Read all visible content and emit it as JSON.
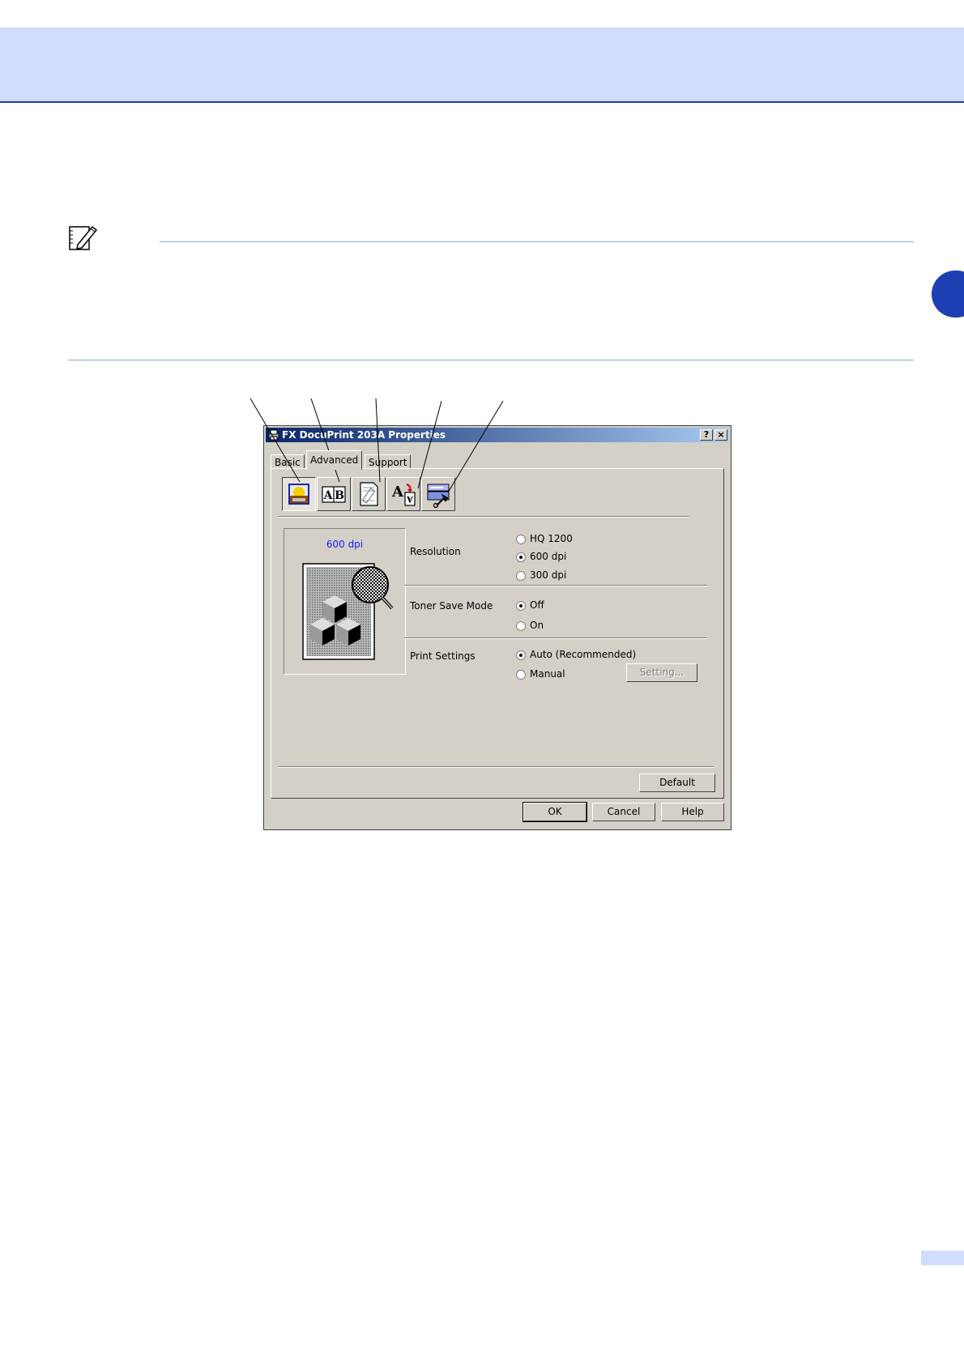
{
  "dialog": {
    "title": "FX DocuPrint 203A Properties",
    "help_glyph": "?",
    "close_glyph": "×",
    "tabs": [
      {
        "label": "Basic"
      },
      {
        "label": "Advanced"
      },
      {
        "label": "Support"
      }
    ],
    "toolbar_icons": [
      "print-quality-icon",
      "duplex-icon",
      "watermark-icon",
      "page-setting-icon",
      "device-options-icon"
    ],
    "preview_dpi": "600 dpi",
    "resolution": {
      "label": "Resolution",
      "options": [
        "HQ 1200",
        "600 dpi",
        "300 dpi"
      ],
      "selected": "600 dpi"
    },
    "toner_save": {
      "label": "Toner Save Mode",
      "options": [
        "Off",
        "On"
      ],
      "selected": "Off"
    },
    "print_settings": {
      "label": "Print Settings",
      "options": [
        "Auto (Recommended)",
        "Manual"
      ],
      "selected": "Auto (Recommended)",
      "setting_button": "Setting..."
    },
    "default_button": "Default",
    "ok_button": "OK",
    "cancel_button": "Cancel",
    "help_button": "Help"
  },
  "colors": {
    "header_band": "#cfdcfc",
    "header_rule": "#1e3ea8",
    "chapter_tab": "#1f3fb5",
    "note_rule": "#8ea4d8"
  }
}
